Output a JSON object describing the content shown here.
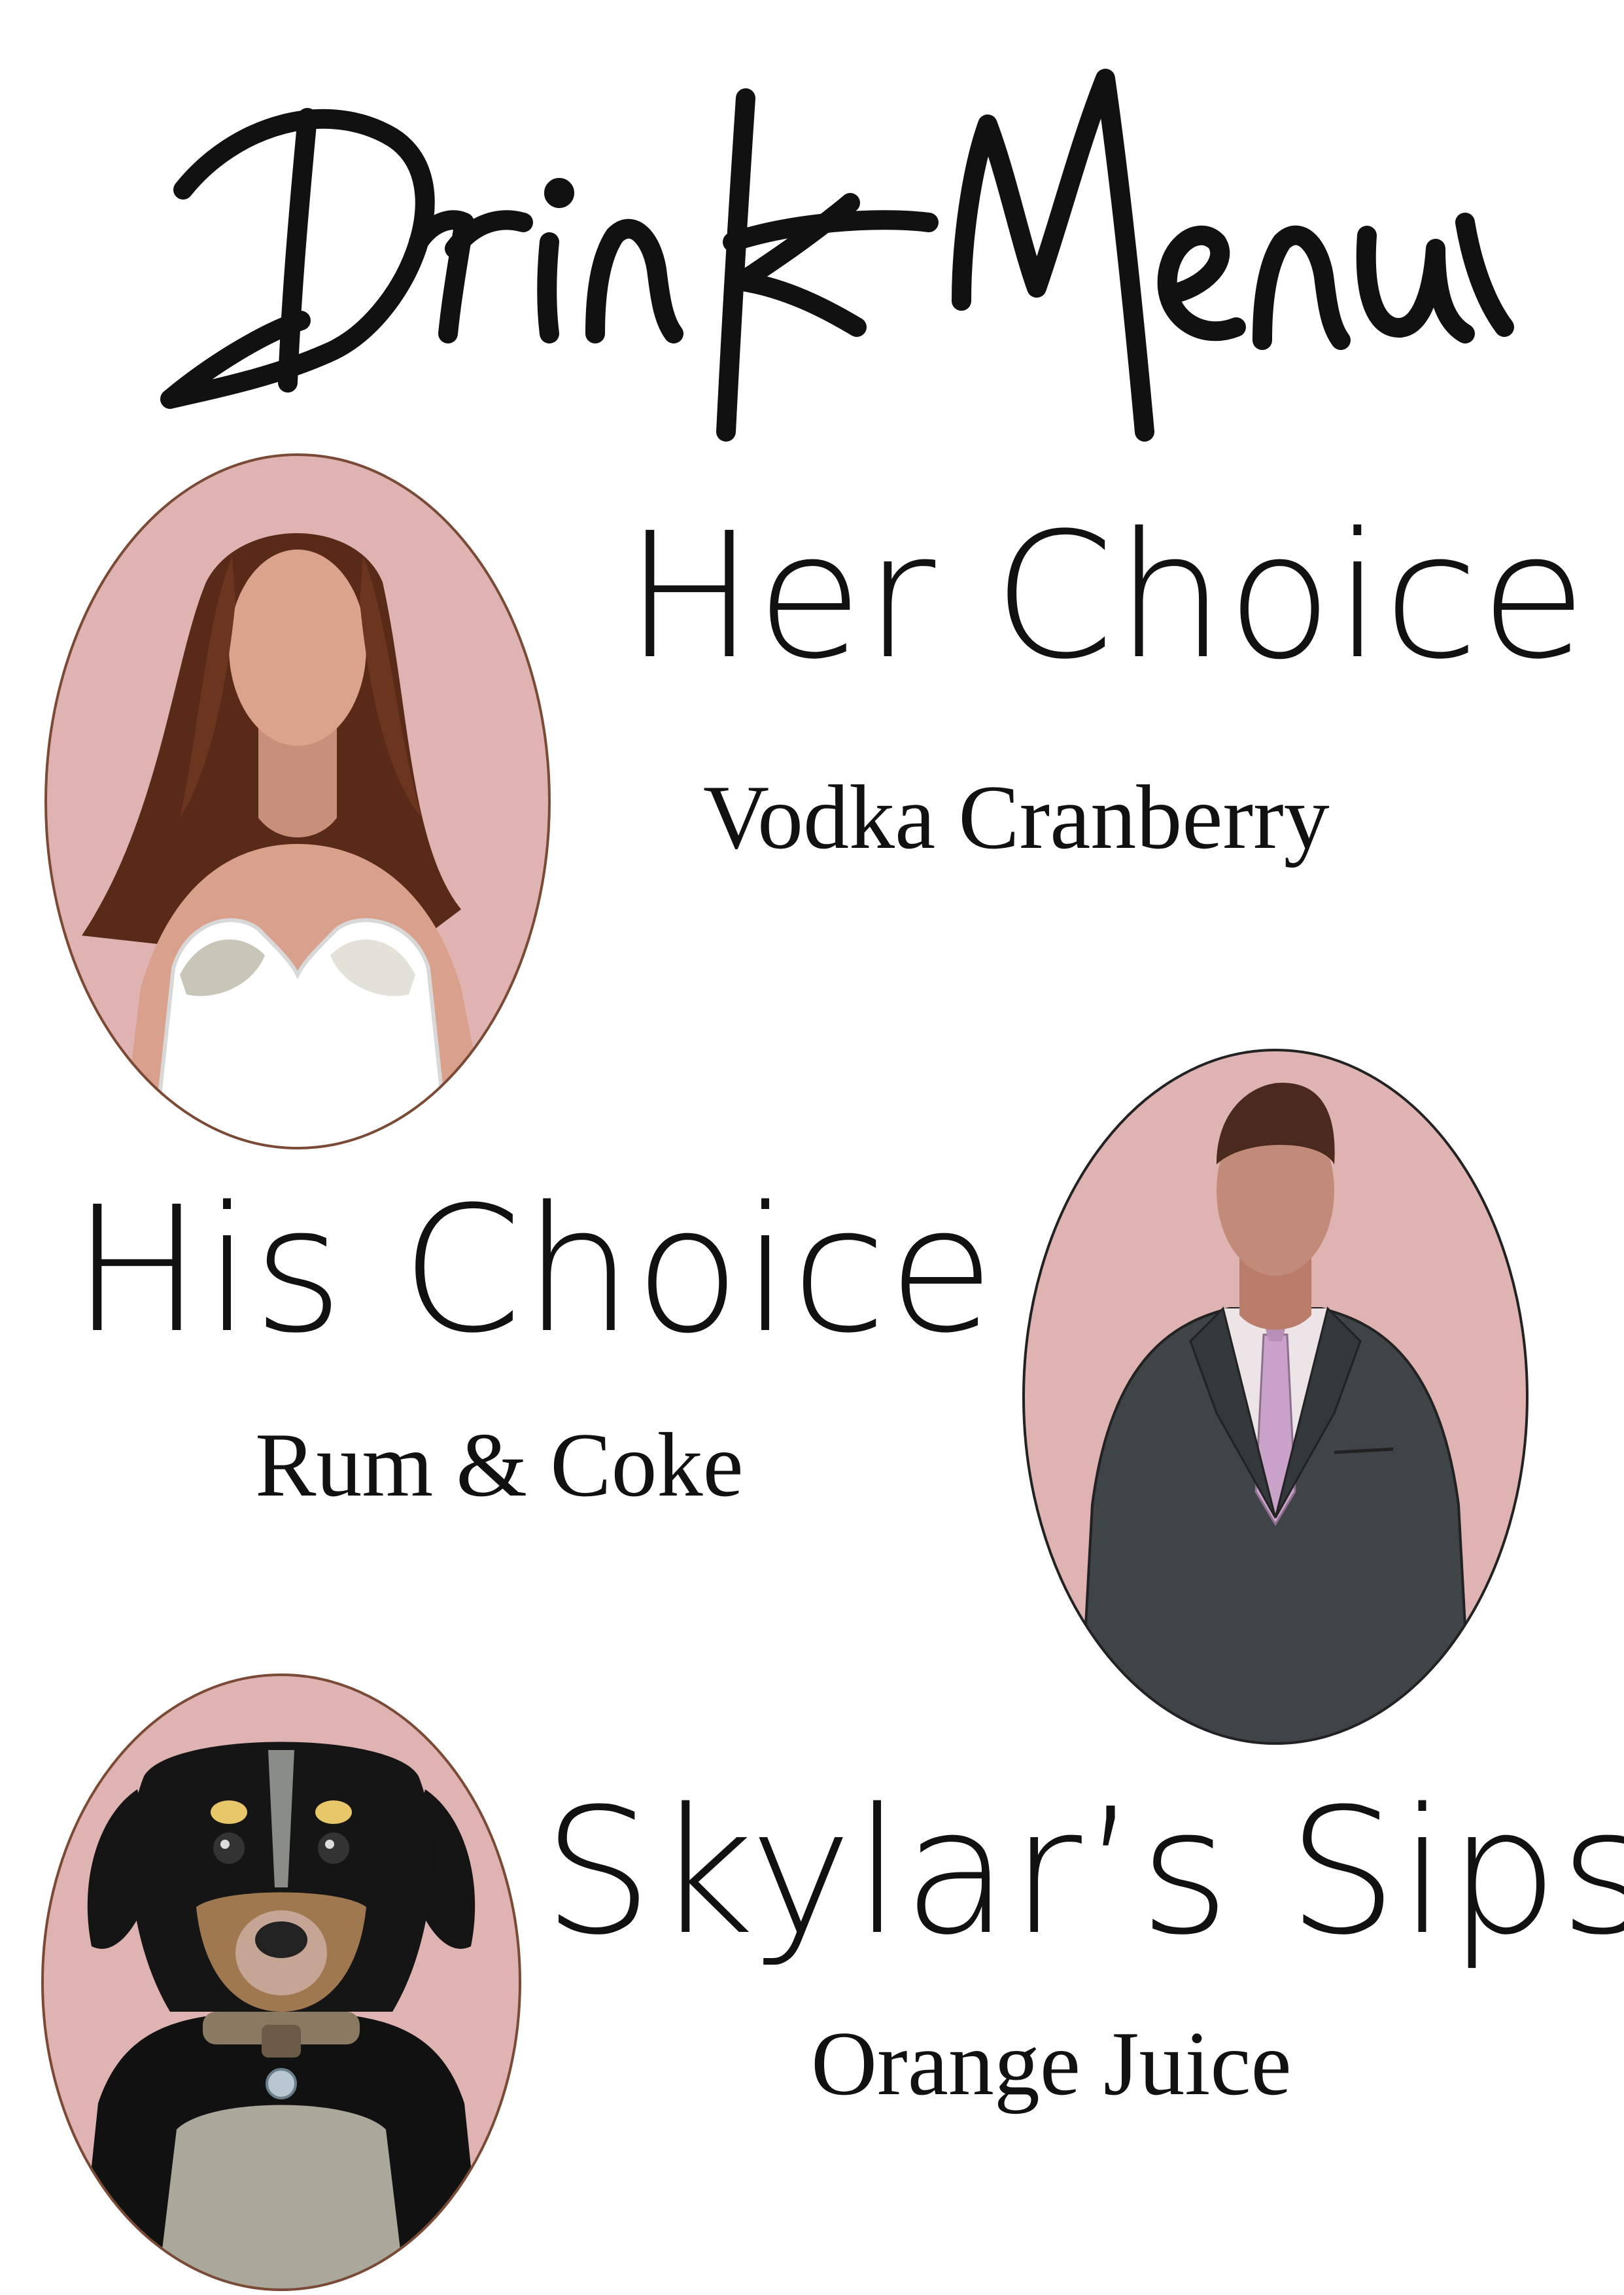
{
  "title": "Drink Menu",
  "items": [
    {
      "heading": "Her Choice",
      "drink": "Vodka Cranberry"
    },
    {
      "heading": "His Choice",
      "drink": "Rum & Coke"
    },
    {
      "heading": "Skylar’s Sips",
      "drink": "Orange Juice"
    }
  ],
  "colors": {
    "portrait_bg": "#deb3b1",
    "portrait_ring": "#7a4a36",
    "text": "#111111"
  }
}
